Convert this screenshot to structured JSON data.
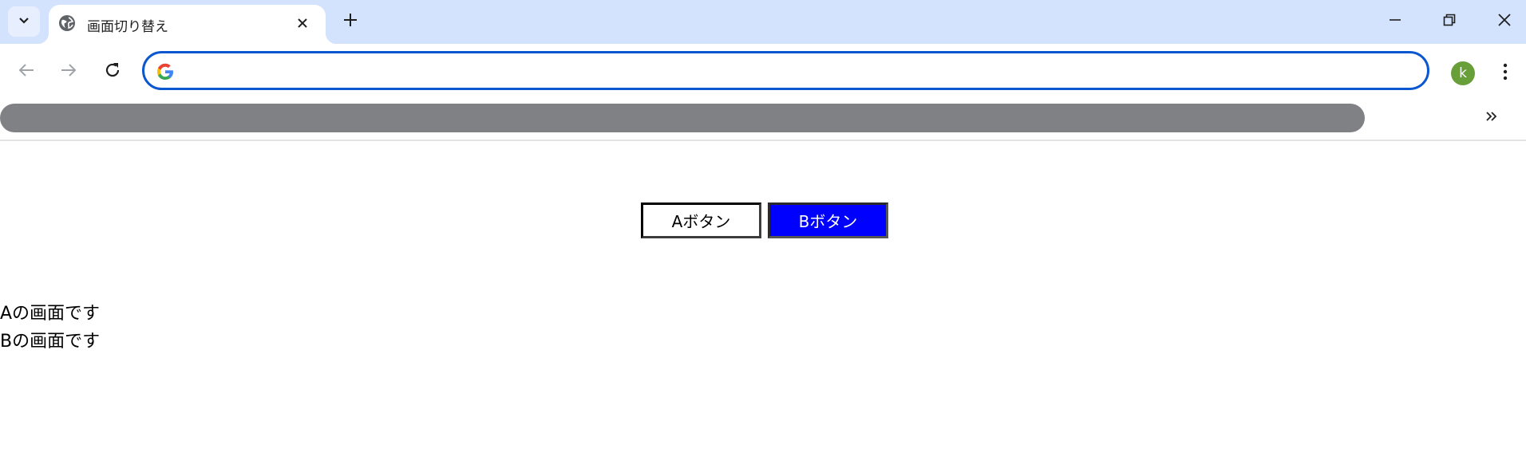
{
  "browser": {
    "tab": {
      "title": "画面切り替え",
      "favicon": "globe-icon"
    },
    "omnibox": {
      "value": "",
      "placeholder": ""
    },
    "profile": {
      "initial": "k",
      "color": "#689f38"
    },
    "accent": "#0b57d0",
    "frame_color": "#d3e3fd"
  },
  "page": {
    "buttons": [
      {
        "label": "Aボタン",
        "background": "#ffffff",
        "text_color": "#000000"
      },
      {
        "label": "Bボタン",
        "background": "#0000ff",
        "text_color": "#ffffff"
      }
    ],
    "screens": [
      {
        "text": "Aの画面です"
      },
      {
        "text": "Bの画面です"
      }
    ]
  }
}
